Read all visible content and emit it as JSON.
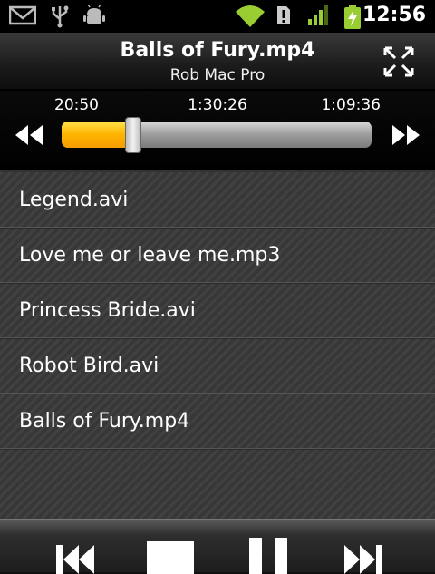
{
  "status_bar": {
    "time": "12:56",
    "icons": [
      "gmail-icon",
      "usb-icon",
      "android-debug-icon",
      "wifi-icon",
      "alert-icon",
      "signal-icon",
      "battery-charging-icon"
    ]
  },
  "header": {
    "title": "Balls of Fury.mp4",
    "subtitle": "Rob Mac Pro",
    "fullscreen_icon": "fullscreen-icon"
  },
  "progress": {
    "elapsed": "20:50",
    "total": "1:30:26",
    "remaining": "1:09:36",
    "fraction": 0.23,
    "accent_color": "#ffb400"
  },
  "playlist": {
    "items": [
      {
        "label": "Legend.avi"
      },
      {
        "label": "Love me or leave me.mp3"
      },
      {
        "label": "Princess Bride.avi"
      },
      {
        "label": "Robot Bird.avi"
      },
      {
        "label": "Balls of Fury.mp4"
      }
    ]
  },
  "controls": {
    "icons": [
      "skip-previous-icon",
      "stop-icon",
      "pause-icon",
      "skip-next-icon"
    ]
  }
}
